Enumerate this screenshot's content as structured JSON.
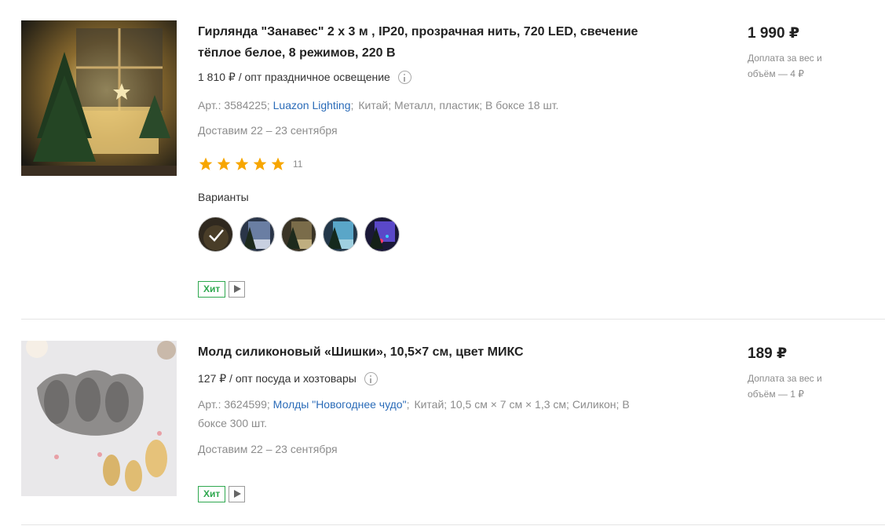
{
  "products": [
    {
      "title": "Гирлянда \"Занавес\" 2 х 3 м , IP20, прозрачная нить, 720 LED, свечение тёплое белое, 8 режимов, 220 В",
      "opt_price": "1 810 ₽ / опт праздничное освещение",
      "article": "Арт.: 3584225;",
      "brand": "Luazon Lighting",
      "meta_rest": [
        "Китай;",
        "Металл, пластик;",
        "В боксе 18 шт."
      ],
      "delivery": "Доставим 22 – 23 сентября",
      "rating_stars": 5,
      "rating_count": "11",
      "variants_label": "Варианты",
      "variant_count": 5,
      "badge": "Хит",
      "price": "1 990 ₽",
      "surcharge": "Доплата за вес и объём — 4 ₽"
    },
    {
      "title": "Молд силиконовый «Шишки», 10,5×7 см, цвет МИКС",
      "opt_price": "127 ₽ / опт посуда и хозтовары",
      "article": "Арт.: 3624599;",
      "brand": "Молды \"Новогоднее чудо\"",
      "meta_rest": [
        "Китай;",
        "10,5 см × 7 см × 1,3 см;",
        "Силикон;",
        "В боксе 300 шт."
      ],
      "delivery": "Доставим 22 – 23 сентября",
      "badge": "Хит",
      "price": "189 ₽",
      "surcharge": "Доплата за вес и объём — 1 ₽"
    }
  ],
  "colors": {
    "brand_link": "#2a6bb8",
    "star": "#f7a600",
    "hit_badge": "#2fa84f"
  },
  "icons": [
    "info-icon",
    "star-icon",
    "checkmark-icon",
    "play-icon"
  ]
}
